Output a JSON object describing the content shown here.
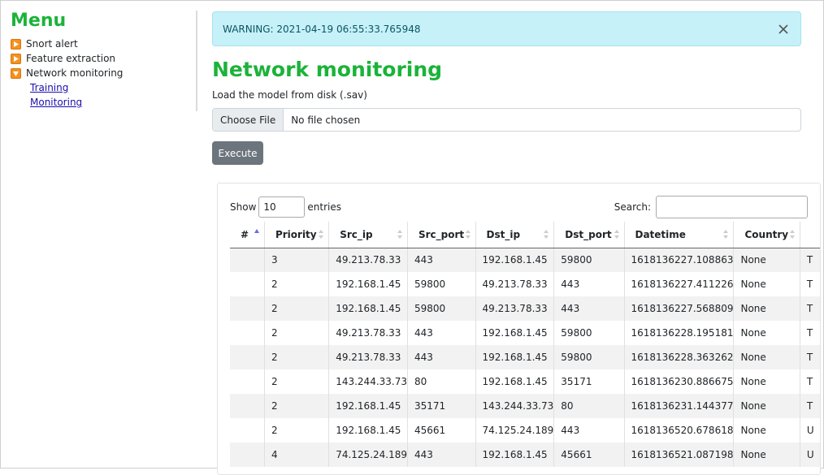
{
  "sidebar": {
    "title": "Menu",
    "items": [
      {
        "label": "Snort alert",
        "state": "collapsed"
      },
      {
        "label": "Feature extraction",
        "state": "collapsed"
      },
      {
        "label": "Network monitoring",
        "state": "expanded"
      }
    ],
    "subitems": [
      {
        "label": "Training"
      },
      {
        "label": "Monitoring"
      }
    ]
  },
  "alert": {
    "text": "WARNING: 2021-04-19 06:55:33.765948",
    "close_icon": "close-icon"
  },
  "main": {
    "title": "Network monitoring",
    "load_label": "Load the model from disk (.sav)",
    "file_button": "Choose File",
    "file_status": "No file chosen",
    "execute_label": "Execute"
  },
  "table_controls": {
    "show_label": "Show",
    "entries_value": "10",
    "entries_label": "entries",
    "search_label": "Search:",
    "search_value": ""
  },
  "table": {
    "columns": [
      "#",
      "Priority",
      "Src_ip",
      "Src_port",
      "Dst_ip",
      "Dst_port",
      "Datetime",
      "Country",
      ""
    ],
    "rows": [
      [
        "",
        "3",
        "49.213.78.33",
        "443",
        "192.168.1.45",
        "59800",
        "1618136227.108863",
        "None",
        "T"
      ],
      [
        "",
        "2",
        "192.168.1.45",
        "59800",
        "49.213.78.33",
        "443",
        "1618136227.411226",
        "None",
        "T"
      ],
      [
        "",
        "2",
        "192.168.1.45",
        "59800",
        "49.213.78.33",
        "443",
        "1618136227.568809",
        "None",
        "T"
      ],
      [
        "",
        "2",
        "49.213.78.33",
        "443",
        "192.168.1.45",
        "59800",
        "1618136228.195181",
        "None",
        "T"
      ],
      [
        "",
        "2",
        "49.213.78.33",
        "443",
        "192.168.1.45",
        "59800",
        "1618136228.363262",
        "None",
        "T"
      ],
      [
        "",
        "2",
        "143.244.33.73",
        "80",
        "192.168.1.45",
        "35171",
        "1618136230.886675",
        "None",
        "T"
      ],
      [
        "",
        "2",
        "192.168.1.45",
        "35171",
        "143.244.33.73",
        "80",
        "1618136231.144377",
        "None",
        "T"
      ],
      [
        "",
        "2",
        "192.168.1.45",
        "45661",
        "74.125.24.189",
        "443",
        "1618136520.678618",
        "None",
        "U"
      ],
      [
        "",
        "4",
        "74.125.24.189",
        "443",
        "192.168.1.45",
        "45661",
        "1618136521.087198",
        "None",
        "U"
      ]
    ]
  },
  "colors": {
    "accent_green": "#1bb339",
    "alert_bg": "#c6f1f8",
    "execute_bg": "#6c757d",
    "tree_icon": "#f5911e",
    "link": "#1a0dab"
  }
}
